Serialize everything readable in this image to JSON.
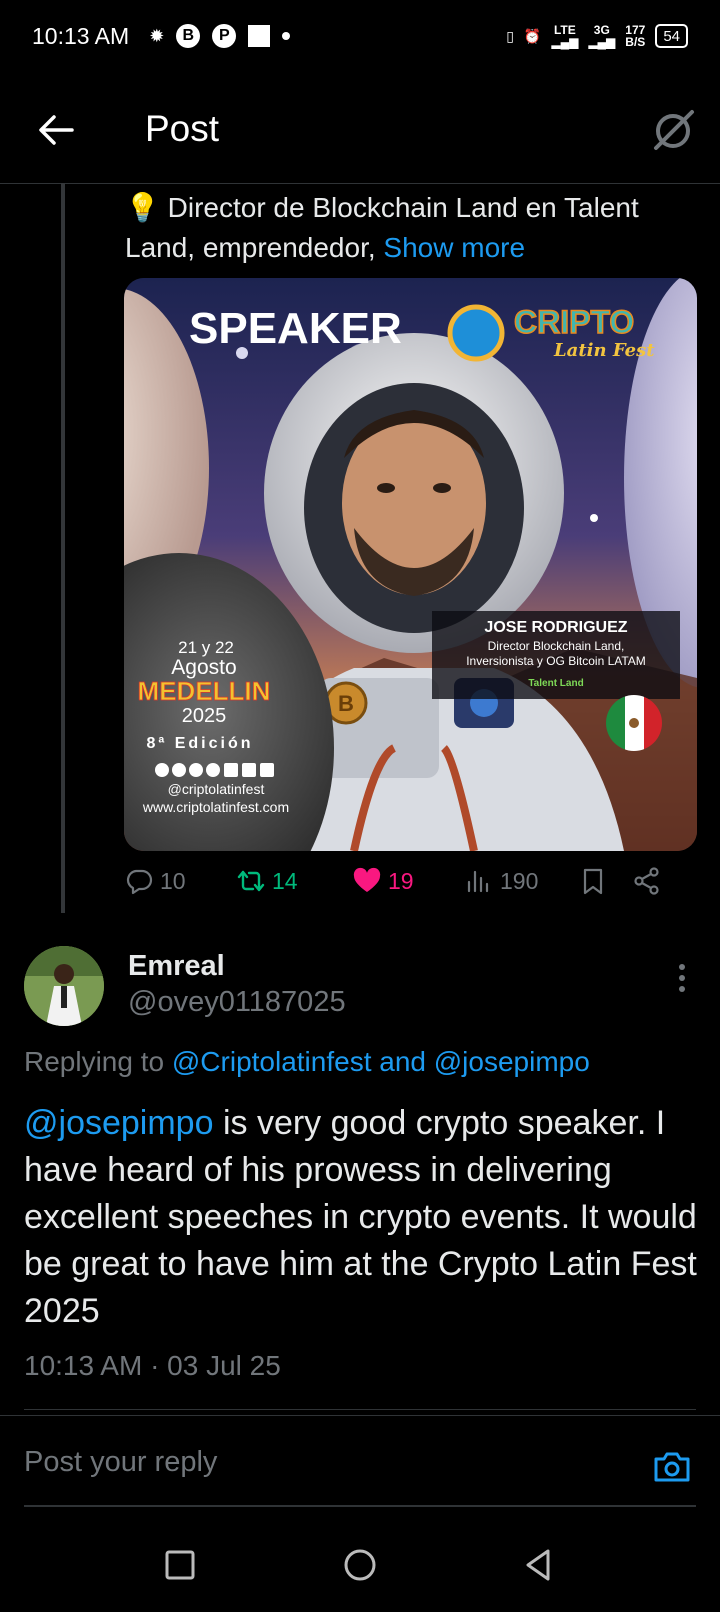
{
  "status_bar": {
    "time": "10:13 AM",
    "lte": "LTE",
    "net_3g": "3G",
    "speed_value": "177",
    "speed_unit": "B/S",
    "battery": "54"
  },
  "header": {
    "title": "Post"
  },
  "post": {
    "bio_text": "💡 Director de Blockchain Land en Talent Land, emprendedor,",
    "show_more": "Show more",
    "image": {
      "speaker_label": "SPEAKER",
      "logo_text": "CRIPTO",
      "logo_sub": "Latin Fest",
      "person_name": "JOSE RODRIGUEZ",
      "person_role_1": "Director Blockchain Land,",
      "person_role_2": "Inversionista y OG Bitcoin LATAM",
      "talent_land": "Talent Land",
      "date_days": "21 y 22",
      "date_month": "Agosto",
      "city": "MEDELLIN",
      "year": "2025",
      "edition": "8ª Edición",
      "social_handle": "@criptolatinfest",
      "website": "www.criptolatinfest.com"
    },
    "stats": {
      "replies": "10",
      "reposts": "14",
      "likes": "19",
      "views": "190"
    }
  },
  "reply": {
    "display_name": "Emreal",
    "handle": "@ovey01187025",
    "replying_prefix": "Replying to",
    "replying_to": "@Criptolatinfest and @josepimpo",
    "mention": "@josepimpo",
    "body": " is  very good crypto speaker. I have heard of his prowess in delivering excellent speeches in crypto events. It would be great to have him at the Crypto Latin Fest 2025",
    "timestamp": "10:13 AM · 03 Jul 25"
  },
  "composer": {
    "placeholder": "Post your reply"
  },
  "colors": {
    "accent": "#1d9bf0",
    "like": "#f91880",
    "repost": "#00ba7c",
    "muted": "#71767b",
    "background": "#000000"
  }
}
